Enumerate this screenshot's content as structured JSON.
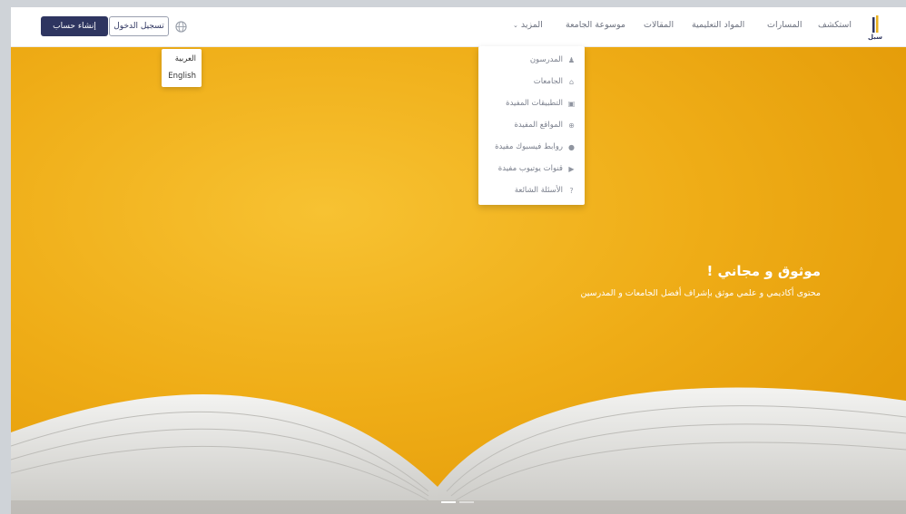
{
  "header": {
    "logo_text": "سبل",
    "nav": [
      {
        "label": "استكشف"
      },
      {
        "label": "المسارات"
      },
      {
        "label": "المواد التعليمية"
      },
      {
        "label": "المقالات"
      },
      {
        "label": "موسوعة الجامعة"
      },
      {
        "label": "المزيد"
      }
    ],
    "signup_label": "إنشاء حساب",
    "login_label": "تسجيل الدخول",
    "globe_icon": "globe-icon"
  },
  "language_menu": {
    "items": [
      "العربية",
      "English"
    ]
  },
  "more_menu": {
    "items": [
      {
        "label": "المدرسون",
        "icon": "teachers-icon"
      },
      {
        "label": "الجامعات",
        "icon": "university-icon"
      },
      {
        "label": "التطبيقات المفيدة",
        "icon": "apps-icon"
      },
      {
        "label": "المواقع المفيدة",
        "icon": "websites-icon"
      },
      {
        "label": "روابط فيسبوك مفيدة",
        "icon": "facebook-icon"
      },
      {
        "label": "قنوات يوتيوب مفيدة",
        "icon": "youtube-icon"
      },
      {
        "label": "الأسئلة الشائعة",
        "icon": "question-icon"
      }
    ]
  },
  "hero": {
    "title": "موثوق و مجاني !",
    "subtitle": "محتوى أكاديمي و علمي موثق بإشراف أفضل الجامعات و المدرسين"
  },
  "colors": {
    "primary": "#2e3560",
    "hero_yellow": "#efad17"
  }
}
